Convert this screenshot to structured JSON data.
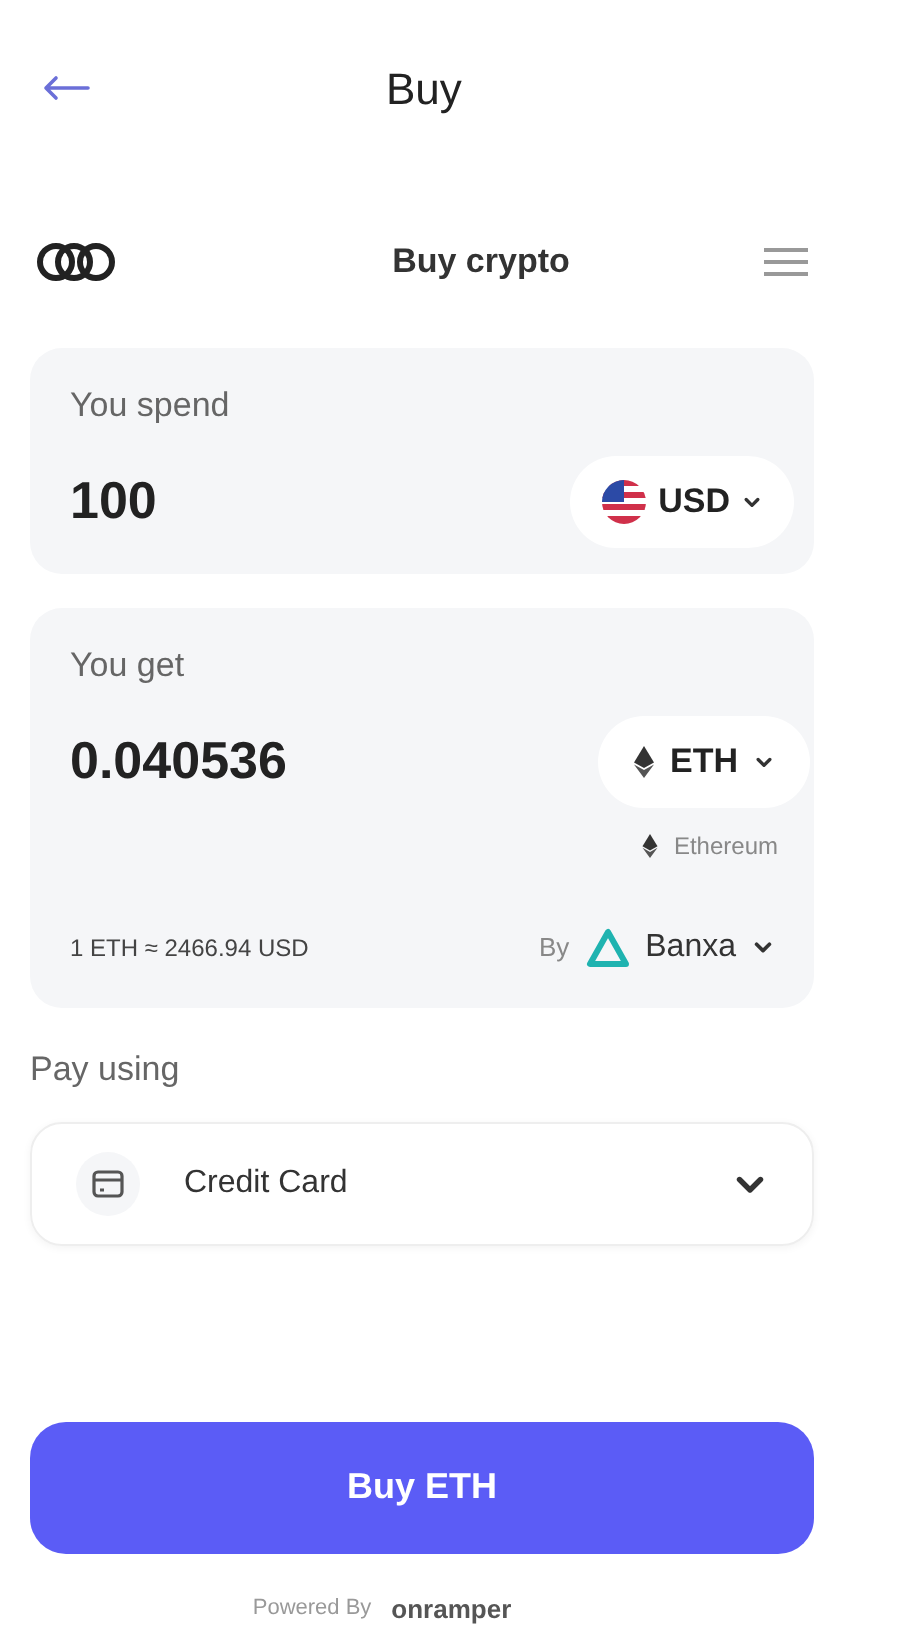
{
  "header": {
    "title": "Buy"
  },
  "widget": {
    "title": "Buy crypto"
  },
  "spend": {
    "label": "You spend",
    "amount": "100",
    "currency": "USD"
  },
  "get": {
    "label": "You get",
    "amount": "0.040536",
    "currency": "ETH",
    "network": "Ethereum",
    "rate": "1 ETH ≈ 2466.94 USD",
    "provider_prefix": "By",
    "provider": "Banxa"
  },
  "payment": {
    "label": "Pay using",
    "method": "Credit Card"
  },
  "buy_button": "Buy ETH",
  "footer": {
    "powered_by": "Powered By",
    "brand": "onramper"
  }
}
